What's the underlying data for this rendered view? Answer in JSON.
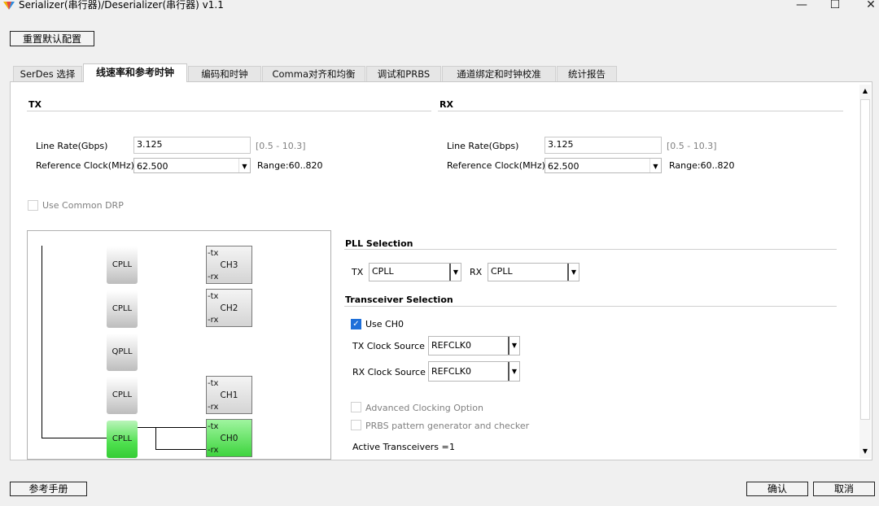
{
  "window": {
    "title": "Serializer(串行器)/Deserializer(串行器) v1.1",
    "minimize": "—",
    "maximize": "☐",
    "close": "✕"
  },
  "toolbar": {
    "reset_label": "重置默认配置"
  },
  "tabs": [
    {
      "label": "SerDes 选择"
    },
    {
      "label": "线速率和参考时钟"
    },
    {
      "label": "编码和时钟"
    },
    {
      "label": "Comma对齐和均衡"
    },
    {
      "label": "调试和PRBS"
    },
    {
      "label": "通道绑定和时钟校准"
    },
    {
      "label": "统计报告"
    }
  ],
  "active_tab": "线速率和参考时钟",
  "tx": {
    "header": "TX",
    "line_rate_label": "Line Rate(Gbps)",
    "line_rate_value": "3.125",
    "line_rate_range": "[0.5 - 10.3]",
    "ref_clock_label": "Reference Clock(MHz)",
    "ref_clock_value": "62.500",
    "ref_clock_range": "Range:60..820"
  },
  "rx": {
    "header": "RX",
    "line_rate_label": "Line Rate(Gbps)",
    "line_rate_value": "3.125",
    "line_rate_range": "[0.5 - 10.3]",
    "ref_clock_label": "Reference Clock(MHz)",
    "ref_clock_value": "62.500",
    "ref_clock_range": "Range:60..820"
  },
  "common_drp": {
    "label": "Use Common DRP",
    "checked": false,
    "enabled": false
  },
  "diagram": {
    "plls": [
      "CPLL",
      "CPLL",
      "QPLL",
      "CPLL",
      "CPLL"
    ],
    "channels": [
      {
        "name": "CH3",
        "tx": "-tx",
        "rx": "-rx"
      },
      {
        "name": "CH2",
        "tx": "-tx",
        "rx": "-rx"
      },
      {
        "name": "CH1",
        "tx": "-tx",
        "rx": "-rx"
      },
      {
        "name": "CH0",
        "tx": "-tx",
        "rx": "-rx"
      }
    ],
    "active_color": "#3ed43e"
  },
  "pll_selection": {
    "header": "PLL Selection",
    "tx_label": "TX",
    "tx_value": "CPLL",
    "rx_label": "RX",
    "rx_value": "CPLL"
  },
  "transceiver_selection": {
    "header": "Transceiver Selection",
    "use_ch0_label": "Use CH0",
    "use_ch0_checked": true,
    "tx_clock_label": "TX Clock Source",
    "tx_clock_value": "REFCLK0",
    "rx_clock_label": "RX Clock Source",
    "rx_clock_value": "REFCLK0",
    "advanced_label": "Advanced Clocking Option",
    "prbs_label": "PRBS pattern generator and checker",
    "active_label": "Active Transceivers =",
    "active_value": "1"
  },
  "footer": {
    "manual_label": "参考手册",
    "ok_label": "确认",
    "cancel_label": "取消"
  },
  "colors": {
    "accent": "#1e6fd9",
    "active_pll": "#36cc36"
  }
}
